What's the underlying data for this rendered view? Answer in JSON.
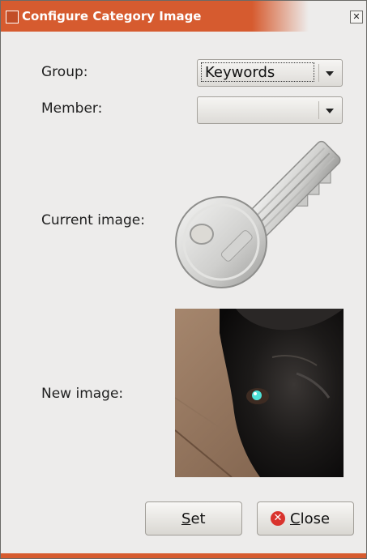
{
  "window": {
    "title": "Configure Category Image"
  },
  "form": {
    "group_label": "Group:",
    "group_value": "Keywords",
    "member_label": "Member:",
    "member_value": "",
    "current_image_label": "Current image:",
    "new_image_label": "New image:"
  },
  "buttons": {
    "set_label_u": "S",
    "set_label_rest": "et",
    "close_label_u": "C",
    "close_label_rest": "lose"
  },
  "icons": {
    "window_icon": "window-icon",
    "close_window": "close-icon",
    "dropdown": "chevron-down-icon",
    "close_button": "cancel-icon",
    "current_image": "key-icon",
    "new_image": "dog-photo"
  },
  "colors": {
    "titlebar": "#d65b2f",
    "background": "#edeceb",
    "close_icon": "#d9332d"
  }
}
